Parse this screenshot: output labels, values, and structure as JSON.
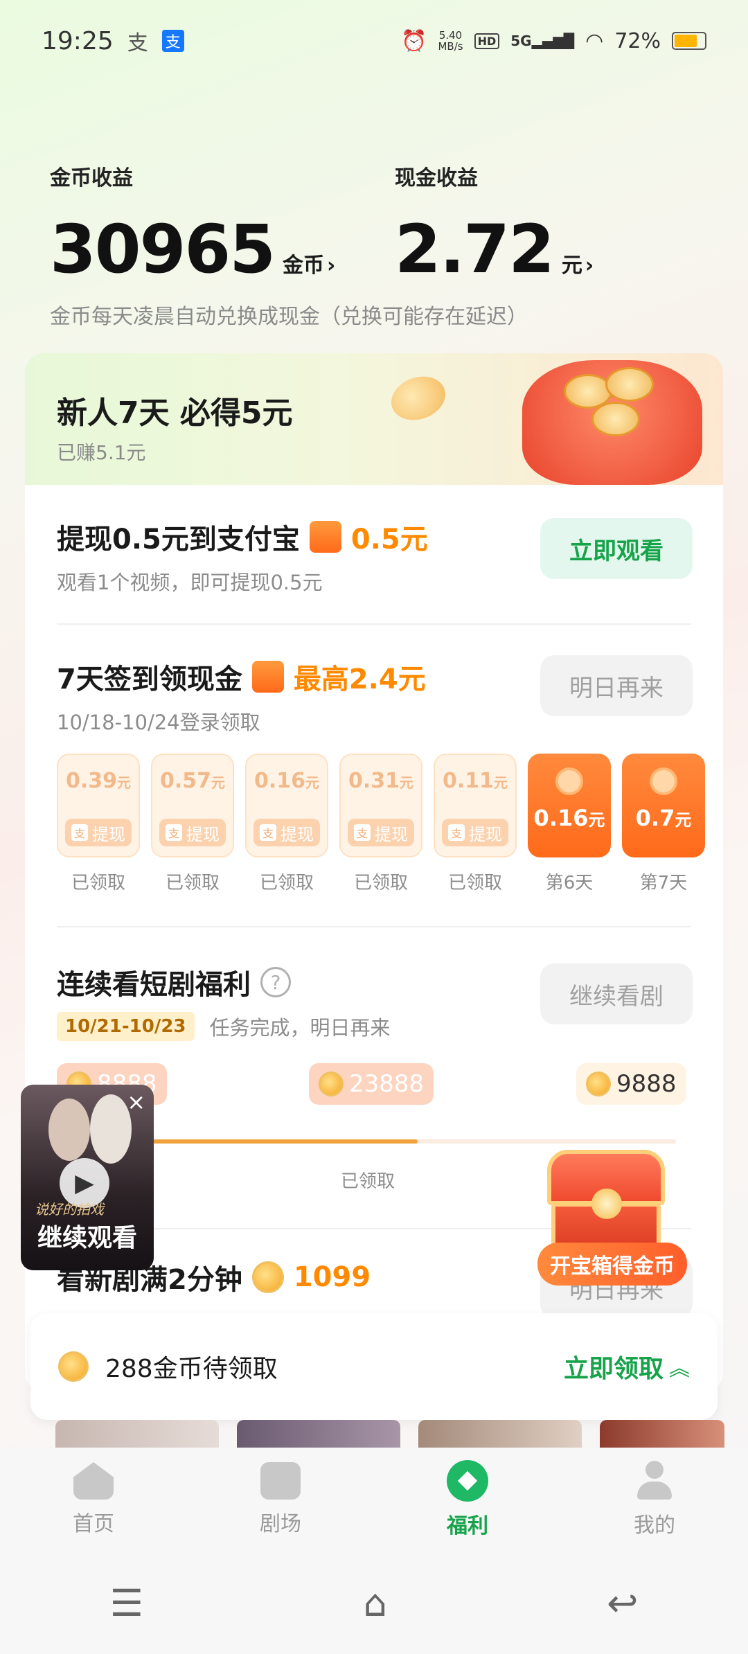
{
  "status": {
    "time": "19:25",
    "left_icons": [
      "alipay-text-icon",
      "alipay-icon"
    ],
    "net_speed": "5.40 MB/s",
    "hd": "HD",
    "signal": "5G",
    "battery": "72%"
  },
  "earnings": {
    "coin_label": "金币收益",
    "coin_value": "30965",
    "coin_unit": "金币",
    "cash_label": "现金收益",
    "cash_value": "2.72",
    "cash_unit": "元",
    "note": "金币每天凌晨自动兑换成现金（兑换可能存在延迟）"
  },
  "promo": {
    "title": "新人7天 必得5元",
    "subtitle": "已赚5.1元"
  },
  "withdraw": {
    "title": "提现0.5元到支付宝",
    "reward": "0.5元",
    "subtitle": "观看1个视频，即可提现0.5元",
    "button": "立即观看"
  },
  "signin": {
    "title": "7天签到领现金",
    "reward": "最高2.4元",
    "subtitle": "10/18-10/24登录领取",
    "button": "明日再来",
    "days": [
      {
        "amount": "0.39",
        "unit": "元",
        "action": "提现",
        "label": "已领取"
      },
      {
        "amount": "0.57",
        "unit": "元",
        "action": "提现",
        "label": "已领取"
      },
      {
        "amount": "0.16",
        "unit": "元",
        "action": "提现",
        "label": "已领取"
      },
      {
        "amount": "0.31",
        "unit": "元",
        "action": "提现",
        "label": "已领取"
      },
      {
        "amount": "0.11",
        "unit": "元",
        "action": "提现",
        "label": "已领取"
      },
      {
        "amount": "0.16",
        "unit": "元",
        "label": "第6天"
      },
      {
        "amount": "0.7",
        "unit": "元",
        "label": "第7天"
      }
    ]
  },
  "drama": {
    "title": "连续看短剧福利",
    "date": "10/21-10/23",
    "status": "任务完成，明日再来",
    "button": "继续看剧",
    "milestones": [
      {
        "coins": "8888"
      },
      {
        "coins": "23888",
        "label": "已领取"
      },
      {
        "coins": "9888"
      }
    ],
    "progress_filled": 0.55
  },
  "watch": {
    "title": "看新剧满2分钟",
    "reward": "1099",
    "button": "明日再来"
  },
  "floating_video": {
    "label": "继续观看",
    "close": "×",
    "poster_text": "说好的拍戏"
  },
  "treasure": {
    "label": "开宝箱得金币"
  },
  "claim": {
    "text": "288金币待领取",
    "button": "立即领取"
  },
  "tabs": [
    {
      "label": "首页"
    },
    {
      "label": "剧场"
    },
    {
      "label": "福利",
      "active": true
    },
    {
      "label": "我的"
    }
  ],
  "accent_green": "#16a34a",
  "accent_orange": "#ff8a00"
}
